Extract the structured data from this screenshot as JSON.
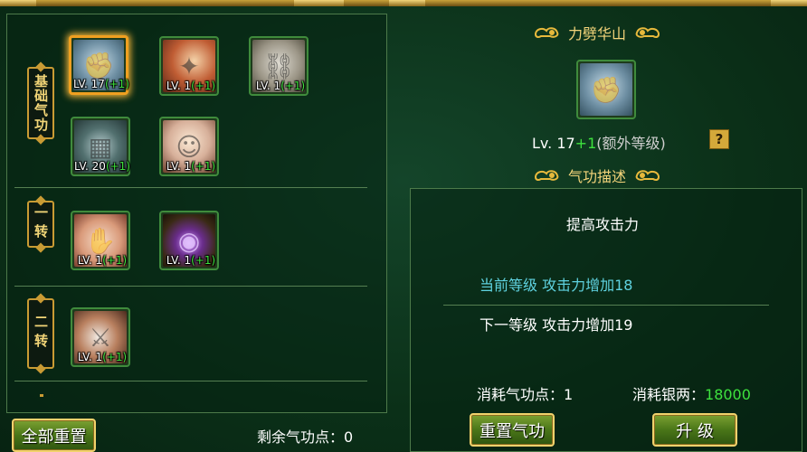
{
  "left": {
    "sections": [
      {
        "label": "基础气功"
      },
      {
        "label": "一转"
      },
      {
        "label": "二转"
      }
    ],
    "skills": [
      {
        "level": "LV. 17",
        "bonus": "(+1)",
        "icon": "fist-chain-icon"
      },
      {
        "level": "LV. 1",
        "bonus": "(+1)",
        "icon": "claw-strike-icon"
      },
      {
        "level": "LV. 1",
        "bonus": "(+1)",
        "icon": "chain-whip-icon"
      },
      {
        "level": "LV. 20",
        "bonus": "(+1)",
        "icon": "armor-icon"
      },
      {
        "level": "LV. 1",
        "bonus": "(+1)",
        "icon": "swordsman-icon"
      },
      {
        "level": "LV. 1",
        "bonus": "(+1)",
        "icon": "palm-icon"
      },
      {
        "level": "LV. 1",
        "bonus": "(+1)",
        "icon": "purple-orb-icon"
      },
      {
        "level": "LV. 1",
        "bonus": "(+1)",
        "icon": "blade-icon"
      }
    ],
    "reset_all_label": "全部重置",
    "remaining_points": "剩余气功点：0"
  },
  "right": {
    "skill_name": "力劈华山",
    "level_text": "Lv. 17",
    "level_bonus": "+1",
    "level_note": "(额外等级)",
    "help_label": "?",
    "desc_title": "气功描述",
    "desc_main": "提高攻击力",
    "current_level": "当前等级  攻击力增加18",
    "next_level": "下一等级  攻击力增加19",
    "cost_points": "消耗气功点：1",
    "cost_silver_label": "消耗银两：",
    "cost_silver_value": "18000",
    "reset_label": "重置气功",
    "upgrade_label": "升 级"
  },
  "colors": {
    "gold": "#f4d47a",
    "cyan_text": "#5fd2e0",
    "green_bonus": "#3ee23e",
    "selected_border": "#f0a020"
  }
}
